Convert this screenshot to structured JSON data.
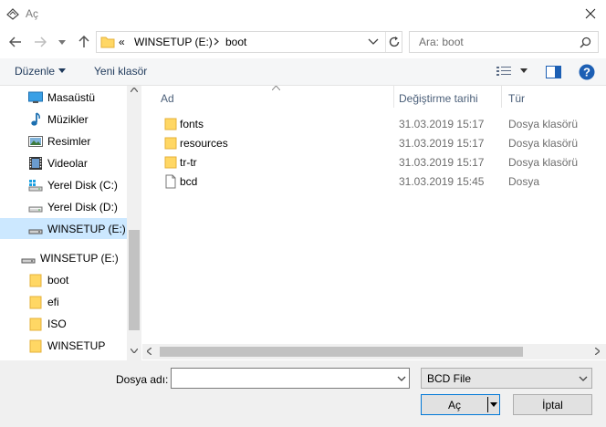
{
  "window": {
    "title": "Aç",
    "close_icon": "close-icon"
  },
  "address": {
    "prefix": "«",
    "segments": [
      "WINSETUP (E:)",
      "boot"
    ],
    "search_placeholder": "Ara: boot"
  },
  "toolbar": {
    "organize_label": "Düzenle",
    "new_folder_label": "Yeni klasör",
    "help_label": "?"
  },
  "nav": {
    "items": [
      {
        "label": "Masaüstü",
        "icon": "desktop-icon"
      },
      {
        "label": "Müzikler",
        "icon": "music-icon"
      },
      {
        "label": "Resimler",
        "icon": "pictures-icon"
      },
      {
        "label": "Videolar",
        "icon": "videos-icon"
      },
      {
        "label": "Yerel Disk (C:)",
        "icon": "windows-drive-icon"
      },
      {
        "label": "Yerel Disk (D:)",
        "icon": "drive-icon"
      },
      {
        "label": "WINSETUP (E:)",
        "icon": "usb-drive-icon",
        "selected": true
      },
      {
        "label": "WINSETUP (E:)",
        "icon": "usb-drive-icon"
      },
      {
        "label": "boot",
        "icon": "folder-icon"
      },
      {
        "label": "efi",
        "icon": "folder-icon"
      },
      {
        "label": "ISO",
        "icon": "folder-icon"
      },
      {
        "label": "WINSETUP",
        "icon": "folder-icon"
      }
    ]
  },
  "files": {
    "columns": [
      "Ad",
      "Değiştirme tarihi",
      "Tür"
    ],
    "rows": [
      {
        "name": "fonts",
        "date": "31.03.2019 15:17",
        "type": "Dosya klasörü",
        "icon": "folder-icon"
      },
      {
        "name": "resources",
        "date": "31.03.2019 15:17",
        "type": "Dosya klasörü",
        "icon": "folder-icon"
      },
      {
        "name": "tr-tr",
        "date": "31.03.2019 15:17",
        "type": "Dosya klasörü",
        "icon": "folder-icon"
      },
      {
        "name": "bcd",
        "date": "31.03.2019 15:45",
        "type": "Dosya",
        "icon": "file-icon"
      }
    ]
  },
  "footer": {
    "filename_label": "Dosya adı:",
    "filename_value": "",
    "filetype_value": "BCD File",
    "open_label": "Aç",
    "cancel_label": "İptal"
  },
  "colors": {
    "accent": "#0078d7",
    "selection": "#cce8ff",
    "folder": "#ffd764",
    "help_blue": "#1c5fb4"
  }
}
